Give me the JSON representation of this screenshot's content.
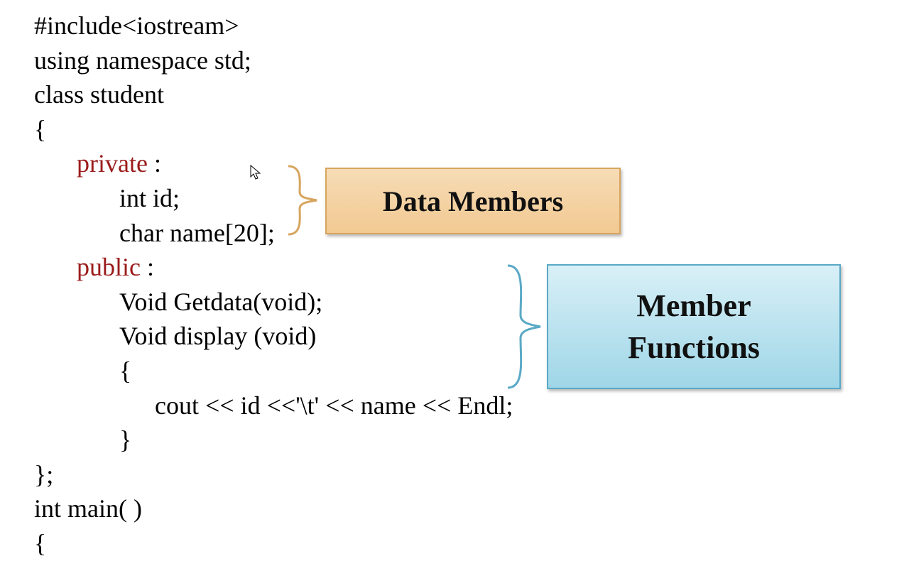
{
  "code": {
    "l1": "#include<iostream>",
    "l2": "using namespace std;",
    "l3": "class student",
    "l4": "{",
    "l5a": "private",
    "l5b": " :",
    "l6": "int id;",
    "l7": "char name[20];",
    "l8a": "public",
    "l8b": " :",
    "l9": "Void Getdata(void);",
    "l10": "Void display (void)",
    "l11": "{",
    "l12": "cout << id <<'\\t' << name << Endl;",
    "l13": "}",
    "l14": "};",
    "l15": "int main( )",
    "l16": "{"
  },
  "labels": {
    "data_members": "Data Members",
    "member_functions": "Member\nFunctions"
  },
  "colors": {
    "keyword": "#9b1c1c",
    "box_data_bg": "#f2c992",
    "box_func_bg": "#9fd6e7"
  }
}
